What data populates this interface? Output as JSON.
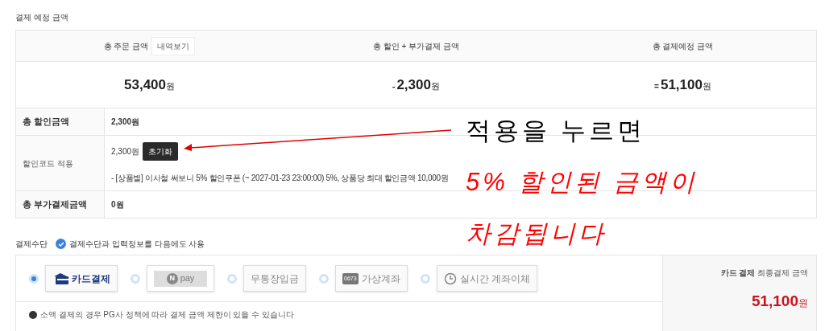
{
  "section_title": "결제 예정 금액",
  "summary": {
    "columns": [
      {
        "label": "총 주문 금액",
        "button": "내역보기"
      },
      {
        "label": "총 할인 + 부가결제 금액"
      },
      {
        "label": "총 결제예정 금액"
      }
    ],
    "values": [
      {
        "amount": "53,400",
        "unit": "원"
      },
      {
        "sign": "-",
        "amount": "2,300",
        "unit": "원"
      },
      {
        "sign": "=",
        "amount": "51,100",
        "unit": "원"
      }
    ]
  },
  "details": [
    {
      "kind": "plain",
      "label": "총 할인금액",
      "value": "2,300원"
    },
    {
      "kind": "coupon",
      "label": "할인코드 적용",
      "amount": "2,300원",
      "button": "초기화",
      "note": "- [상품별] 이사철 써보니 5% 할인쿠폰 (~ 2027-01-23 23:00:00) 5%, 상품당 최대 할인금액 10,000원"
    },
    {
      "kind": "plain",
      "label": "총 부가결제금액",
      "value": "0원"
    }
  ],
  "annotation": {
    "lines": [
      {
        "text": "적용을 누르면",
        "italic": false,
        "color": "#000000"
      },
      {
        "text": "5% 할인된 금액이",
        "italic": true,
        "color": "#ff0000"
      },
      {
        "text": "차감됩니다",
        "italic": true,
        "color": "#ff0000"
      }
    ]
  },
  "payment": {
    "title": "결제수단",
    "save_option": {
      "label": "결제수단과 입력정보를 다음에도 사용",
      "checked": true
    },
    "methods": [
      {
        "kind": "card",
        "label": "카드결제",
        "selected": true
      },
      {
        "kind": "npay",
        "badge": "N",
        "label": "pay",
        "selected": false
      },
      {
        "kind": "text",
        "label": "무통장입금",
        "selected": false
      },
      {
        "kind": "virtual",
        "badge": "0673",
        "label": "가상계좌",
        "selected": false
      },
      {
        "kind": "transfer",
        "label": "실시간 계좌이체",
        "selected": false
      }
    ],
    "notice": "소액 결제의 경우 PG사 정책에 따라 결제 금액 제한이 있을 수 있습니다",
    "total": {
      "title": "**카드 결제** 최종결제 금액",
      "amount": "51,100",
      "unit": "원"
    }
  }
}
